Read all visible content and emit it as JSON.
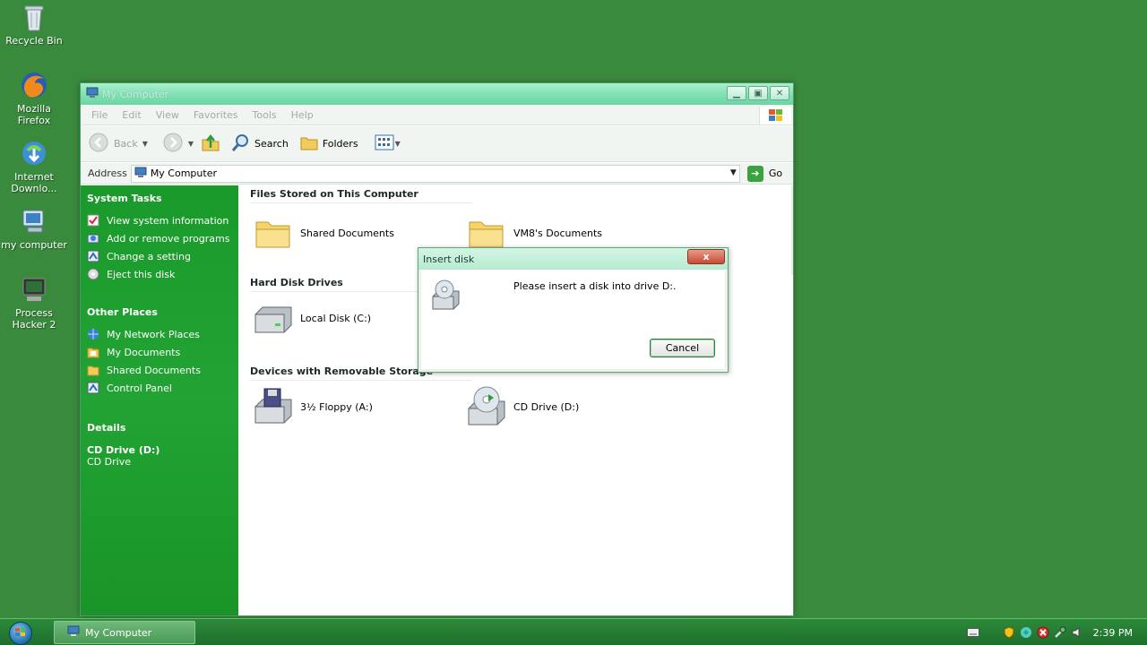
{
  "desktop": {
    "icons": [
      {
        "label": "Recycle Bin",
        "icon": "recycle-bin-icon"
      },
      {
        "label": "Mozilla\nFirefox",
        "icon": "firefox-icon"
      },
      {
        "label": "Internet\nDownlo...",
        "icon": "internet-download-manager-icon"
      },
      {
        "label": "my computer",
        "icon": "my-computer-icon"
      },
      {
        "label": "Process\nHacker 2",
        "icon": "process-hacker-icon"
      }
    ]
  },
  "window": {
    "title": "My Computer",
    "menu": [
      "File",
      "Edit",
      "View",
      "Favorites",
      "Tools",
      "Help"
    ],
    "toolbar": {
      "back_label": "Back",
      "search_label": "Search",
      "folders_label": "Folders"
    },
    "address": {
      "label": "Address",
      "value": "My Computer",
      "go_label": "Go"
    },
    "taskpane": {
      "system_tasks": {
        "title": "System Tasks",
        "items": [
          {
            "label": "View system information",
            "icon": "system-info-icon"
          },
          {
            "label": "Add or remove programs",
            "icon": "add-remove-programs-icon"
          },
          {
            "label": "Change a setting",
            "icon": "control-panel-icon"
          },
          {
            "label": "Eject this disk",
            "icon": "eject-disk-icon"
          }
        ]
      },
      "other_places": {
        "title": "Other Places",
        "items": [
          {
            "label": "My Network Places",
            "icon": "network-places-icon"
          },
          {
            "label": "My Documents",
            "icon": "my-documents-icon"
          },
          {
            "label": "Shared Documents",
            "icon": "shared-documents-icon"
          },
          {
            "label": "Control Panel",
            "icon": "control-panel-icon"
          }
        ]
      },
      "details": {
        "title": "Details",
        "name": "CD Drive (D:)",
        "type": "CD Drive"
      }
    },
    "content": {
      "groups": [
        {
          "title": "Files Stored on This Computer",
          "items": [
            "Shared Documents",
            "VM8's Documents"
          ]
        },
        {
          "title": "Hard Disk Drives",
          "items": [
            "Local Disk (C:)"
          ]
        },
        {
          "title": "Devices with Removable Storage",
          "items": [
            "3½ Floppy (A:)",
            "CD Drive (D:)"
          ]
        }
      ]
    }
  },
  "dialog": {
    "title": "Insert disk",
    "message": "Please insert a disk into drive D:.",
    "cancel_label": "Cancel",
    "close_label": "x"
  },
  "taskbar": {
    "task_label": "My Computer",
    "clock": "2:39 PM"
  },
  "colors": {
    "desktop": "#3a8a3e",
    "taskpane": "#1f9e2f",
    "titlebar": "#7fe0b2"
  }
}
